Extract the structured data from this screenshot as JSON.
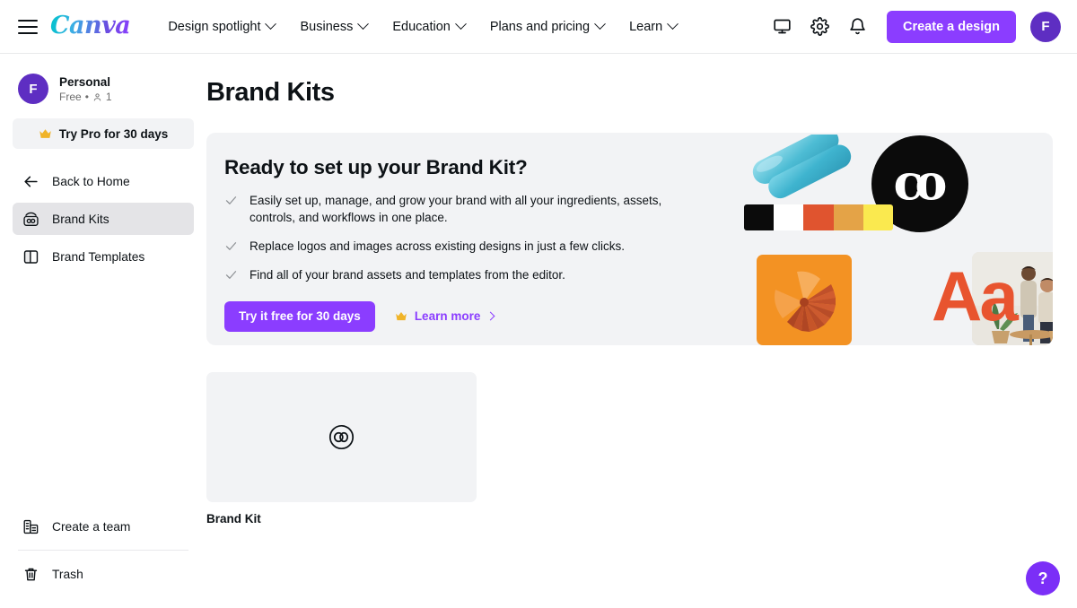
{
  "header": {
    "menu_icon": "hamburger-icon",
    "logo_text": "Canva",
    "nav": [
      {
        "label": "Design spotlight",
        "icon": "chevron-down-icon"
      },
      {
        "label": "Business",
        "icon": "chevron-down-icon"
      },
      {
        "label": "Education",
        "icon": "chevron-down-icon"
      },
      {
        "label": "Plans and pricing",
        "icon": "chevron-down-icon"
      },
      {
        "label": "Learn",
        "icon": "chevron-down-icon"
      }
    ],
    "actions": {
      "display_icon": "monitor-icon",
      "settings_icon": "gear-icon",
      "notifications_icon": "bell-icon",
      "create_label": "Create a design",
      "avatar_initial": "F"
    }
  },
  "sidebar": {
    "profile": {
      "avatar_initial": "F",
      "name": "Personal",
      "plan": "Free",
      "separator": "•",
      "members_icon": "person-icon",
      "members_count": "1"
    },
    "try_pro": {
      "label": "Try Pro for 30 days",
      "icon": "crown-icon"
    },
    "items": [
      {
        "label": "Back to Home",
        "icon": "arrow-left-icon",
        "active": false
      },
      {
        "label": "Brand Kits",
        "icon": "brand-kit-icon",
        "active": true
      },
      {
        "label": "Brand Templates",
        "icon": "brand-template-icon",
        "active": false
      }
    ],
    "bottom_items": [
      {
        "label": "Create a team",
        "icon": "team-icon"
      },
      {
        "label": "Trash",
        "icon": "trash-icon"
      }
    ]
  },
  "main": {
    "page_title": "Brand Kits",
    "banner": {
      "heading": "Ready to set up your Brand Kit?",
      "bullets": [
        "Easily set up, manage, and grow your brand with all your ingredients, assets, controls, and workflows in one place.",
        "Replace logos and images across existing designs in just a few clicks.",
        "Find all of your brand assets and templates from the editor."
      ],
      "bullet_icon": "check-icon",
      "cta_label": "Try it free for 30 days",
      "learn_more_label": "Learn more",
      "learn_more_icon": "crown-icon",
      "learn_more_chevron": "chevron-right-icon",
      "art": {
        "logo_text": "co",
        "type_sample": "Aa",
        "palette": [
          "#0b0b0b",
          "#ffffff",
          "#e0542f",
          "#e5a council",
          "#fae94f"
        ],
        "palette_colors": [
          "#0b0b0b",
          "#ffffff",
          "#e0542f",
          "#e4a347",
          "#fae94f"
        ]
      }
    },
    "kits": [
      {
        "label": "Brand Kit",
        "thumb_icon": "co-logo-icon"
      }
    ]
  },
  "help": {
    "label": "?",
    "icon": "question-mark-icon"
  },
  "colors": {
    "brand_purple": "#8b3dff",
    "avatar_purple": "#5e2ec2",
    "banner_bg": "#f2f3f5",
    "active_item_bg": "#e4e4e7",
    "text": "#0d1216",
    "muted_text": "#6e6e6e"
  }
}
